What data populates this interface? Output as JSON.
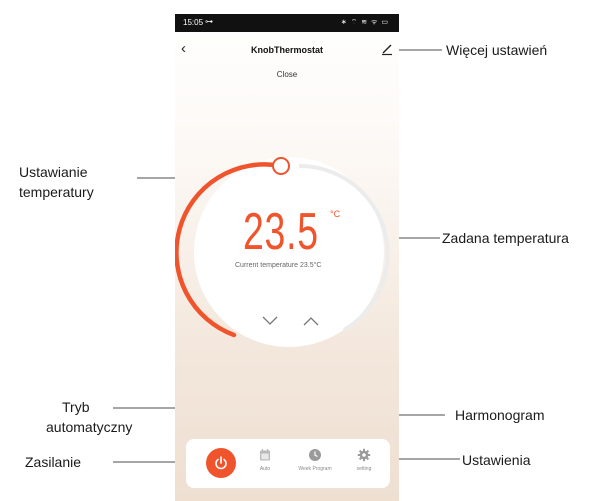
{
  "status_bar": {
    "time": "15:05",
    "key_glyph": "⊶",
    "icons": "∗ ⌔ ≋ ᯤ ▭"
  },
  "header": {
    "back_glyph": "‹",
    "title": "KnobThermostat",
    "subtitle": "Close"
  },
  "dial": {
    "set_temperature": "23.5",
    "unit": "°C",
    "current_label": "Current temperature 23.5°C",
    "accent_color": "#f0542d"
  },
  "bottom_bar": {
    "tabs": [
      {
        "label": "Auto",
        "icon": "calendar-icon"
      },
      {
        "label": "Week Program",
        "icon": "clock-icon"
      },
      {
        "label": "setting",
        "icon": "gear-icon"
      }
    ],
    "power_icon": "power-icon"
  },
  "callouts": {
    "more_settings": "Więcej ustawień",
    "temp_setting_1": "Ustawianie",
    "temp_setting_2": "temperatury",
    "set_temperature": "Zadana temperatura",
    "auto_mode_1": "Tryb",
    "auto_mode_2": "automatyczny",
    "schedule": "Harmonogram",
    "power": "Zasilanie",
    "settings": "Ustawienia"
  }
}
